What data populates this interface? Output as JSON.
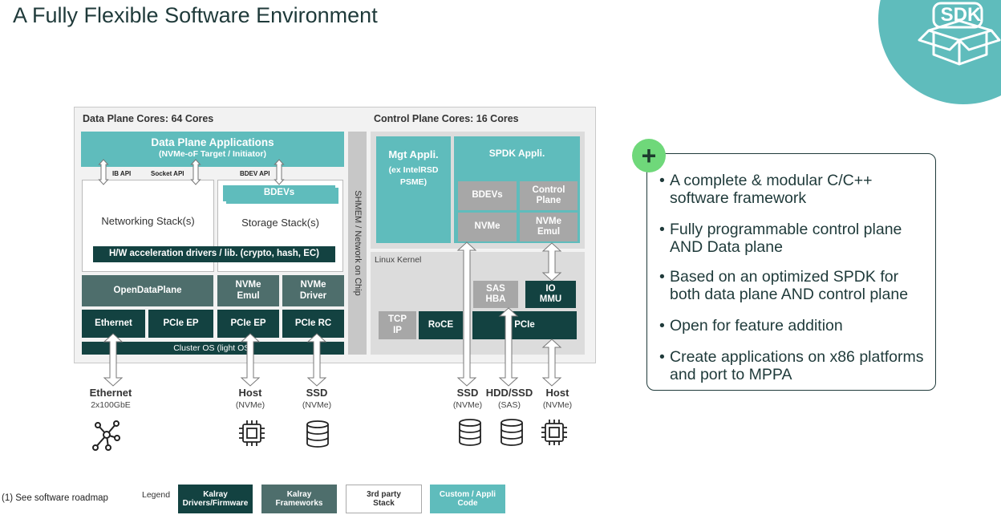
{
  "title": "A Fully Flexible Software Environment",
  "badge": {
    "label": "SDK"
  },
  "diagram": {
    "data_plane": {
      "header": "Data Plane Cores: 64 Cores",
      "apps_title": "Data Plane Applications",
      "apps_subtitle": "(NVMe-oF Target / Initiator)",
      "ib_api": "IB API",
      "socket_api": "Socket API",
      "bdev_api": "BDEV API",
      "networking": "Networking Stack(s)",
      "bdevs": "BDEVs",
      "storage": "Storage Stack(s)",
      "hw_accel": "H/W acceleration drivers / lib. (crypto, hash,  EC)",
      "odp": "OpenDataPlane",
      "nvme_emul": "NVMe Emul",
      "nvme_driver": "NVMe Driver",
      "ethernet": "Ethernet",
      "pcie_ep1": "PCIe EP",
      "pcie_ep2": "PCIe EP",
      "pcie_rc": "PCIe RC",
      "cluster_os": "Cluster OS    (light OS)"
    },
    "shmem": "SHMEM / Network on Chip",
    "control_plane": {
      "header": "Control Plane Cores: 16 Cores",
      "mgt_title": "Mgt Appli.",
      "mgt_sub": "(ex IntelRSD PSME)",
      "spdk_title": "SPDK Appli.",
      "bdevs": "BDEVs",
      "control_plane": "Control Plane",
      "nvme": "NVMe",
      "nvme_emul": "NVMe Emul",
      "linux_kernel": "Linux Kernel",
      "sas_hba": "SAS HBA",
      "io_mmu": "IO MMU",
      "tcp_ip": "TCP IP",
      "roce": "RoCE",
      "pcie": "PCIe"
    },
    "endpoints": [
      {
        "label": "Ethernet",
        "sub": "2x100GbE",
        "icon": "network-icon"
      },
      {
        "label": "Host",
        "sub": "(NVMe)",
        "icon": "chip-icon"
      },
      {
        "label": "SSD",
        "sub": "(NVMe)",
        "icon": "database-icon"
      },
      {
        "label": "SSD",
        "sub": "(NVMe)",
        "icon": "database-icon"
      },
      {
        "label": "HDD/SSD",
        "sub": "(SAS)",
        "icon": "database-icon"
      },
      {
        "label": "Host",
        "sub": "(NVMe)",
        "icon": "chip-icon"
      }
    ]
  },
  "features": {
    "items": [
      {
        "line1": "A complete & modular C/C++",
        "line2": "software framework"
      },
      {
        "line1": "Fully programmable control plane",
        "line2": "AND Data plane"
      },
      {
        "line1": "Based on an optimized SPDK for",
        "line2": "both data plane AND control plane"
      },
      {
        "line1": "Open for feature addition",
        "line2": ""
      },
      {
        "line1": "Create applications on x86 platforms",
        "line2": "and port to MPPA"
      }
    ]
  },
  "legend": {
    "label": "Legend",
    "items": [
      {
        "text": "Kalray Drivers/Firmware",
        "color": "#134241"
      },
      {
        "text": "Kalray Frameworks",
        "color": "#4e6e6c"
      },
      {
        "text": "3rd party Stack",
        "color": "#ffffff"
      },
      {
        "text": "Custom / Appli Code",
        "color": "#5fbcbc"
      }
    ]
  },
  "footnote": "(1) See software roadmap",
  "colors": {
    "teal": "#5fbcbc",
    "dark_teal": "#134241",
    "mid_teal": "#4e6e6c",
    "gray": "#a7a7a7",
    "plus_green": "#6fd87a"
  }
}
